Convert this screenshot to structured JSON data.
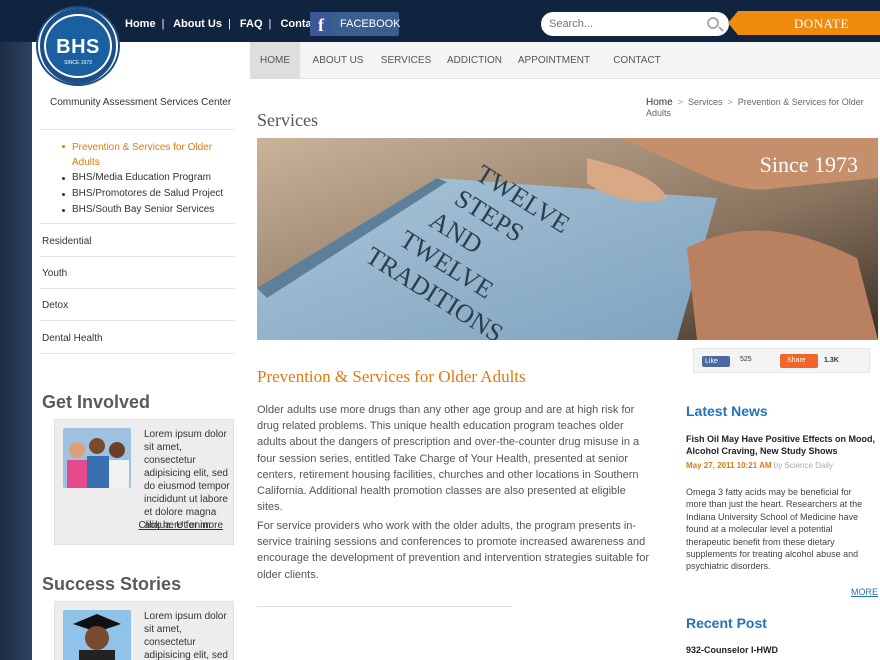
{
  "header": {
    "logo": {
      "text": "BHS",
      "ring_text": "BEHAVIORAL HEALTH SERVICES INC. · A TRADITION OF CARING",
      "since": "SINCE 1973"
    },
    "top_links": [
      "Home",
      "About Us",
      "FAQ",
      "Contact"
    ],
    "facebook_label": "FACEBOOK",
    "search_placeholder": "Search...",
    "donate_label": "DONATE"
  },
  "nav": {
    "items": [
      "HOME",
      "ABOUT US",
      "SERVICES",
      "ADDICTION",
      "APPOINTMENT",
      "CONTACT"
    ],
    "active": "HOME"
  },
  "sidebar": {
    "top": "Community Assessment Services Center",
    "sub_items": [
      {
        "label": "Prevention & Services for Older Adults",
        "active": true
      },
      {
        "label": "BHS/Media Education Program"
      },
      {
        "label": "BHS/Promotores de Salud Project"
      },
      {
        "label": "BHS/South Bay Senior Services"
      }
    ],
    "items": [
      "Residential",
      "Youth",
      "Detox",
      "Dental Health"
    ],
    "get_involved": {
      "heading": "Get Involved",
      "text": "Lorem ipsum dolor sit amet, consectetur adipisicing elit, sed do eiusmod tempor incididunt ut labore et dolore magna aliqua. Ut enim",
      "link": "Click here for more"
    },
    "success_stories": {
      "heading": "Success Stories",
      "text": "Lorem ipsum dolor sit amet, consectetur adipisicing elit, sed do eiusmod tempor"
    }
  },
  "breadcrumb": [
    "Home",
    "Services",
    "Prevention & Services for Older Adults"
  ],
  "page_title": "Services",
  "hero": {
    "caption": "Since 1973",
    "book_text": "TWELVE STEPS AND TWELVE TRADITIONS"
  },
  "social": {
    "like_label": "Like",
    "like_count": "525",
    "share_label": "Share",
    "share_count": "1.3K"
  },
  "content": {
    "heading": "Prevention & Services for Older Adults",
    "paragraphs": [
      "Older adults use more drugs than any other age group and are at high risk for drug related problems. This unique health education program teaches older adults about the dangers of prescription and over-the-counter drug misuse in a four session series, entitled Take Charge of Your Health, presented at senior centers, retirement housing facilities, churches and other locations in Southern California. Additional health promotion classes are also presented at eligible sites.",
      "For service providers who work with the older adults, the program presents in-service training sessions and conferences to promote increased awareness and encourage the development of prevention and intervention strategies suitable for older clients."
    ]
  },
  "latest_news": {
    "heading": "Latest News",
    "title": "Fish Oil May Have Positive Effects on Mood, Alcohol Craving, New Study Shows",
    "date": "May 27, 2011 10:21 AM",
    "by": "by Science Daily",
    "body": "Omega 3 fatty acids may be beneficial for more than just the heart. Researchers at the Indiana University School of Medicine have found at a molecular level a potential therapeutic benefit from these dietary supplements for treating alcohol abuse and psychiatric disorders.",
    "more": "MORE"
  },
  "recent_post": {
    "heading": "Recent Post",
    "first": "932-Counselor I-HWD"
  },
  "colors": {
    "accent_orange": "#e07a10",
    "link_blue": "#2473b8",
    "header_navy": "#10233f"
  }
}
